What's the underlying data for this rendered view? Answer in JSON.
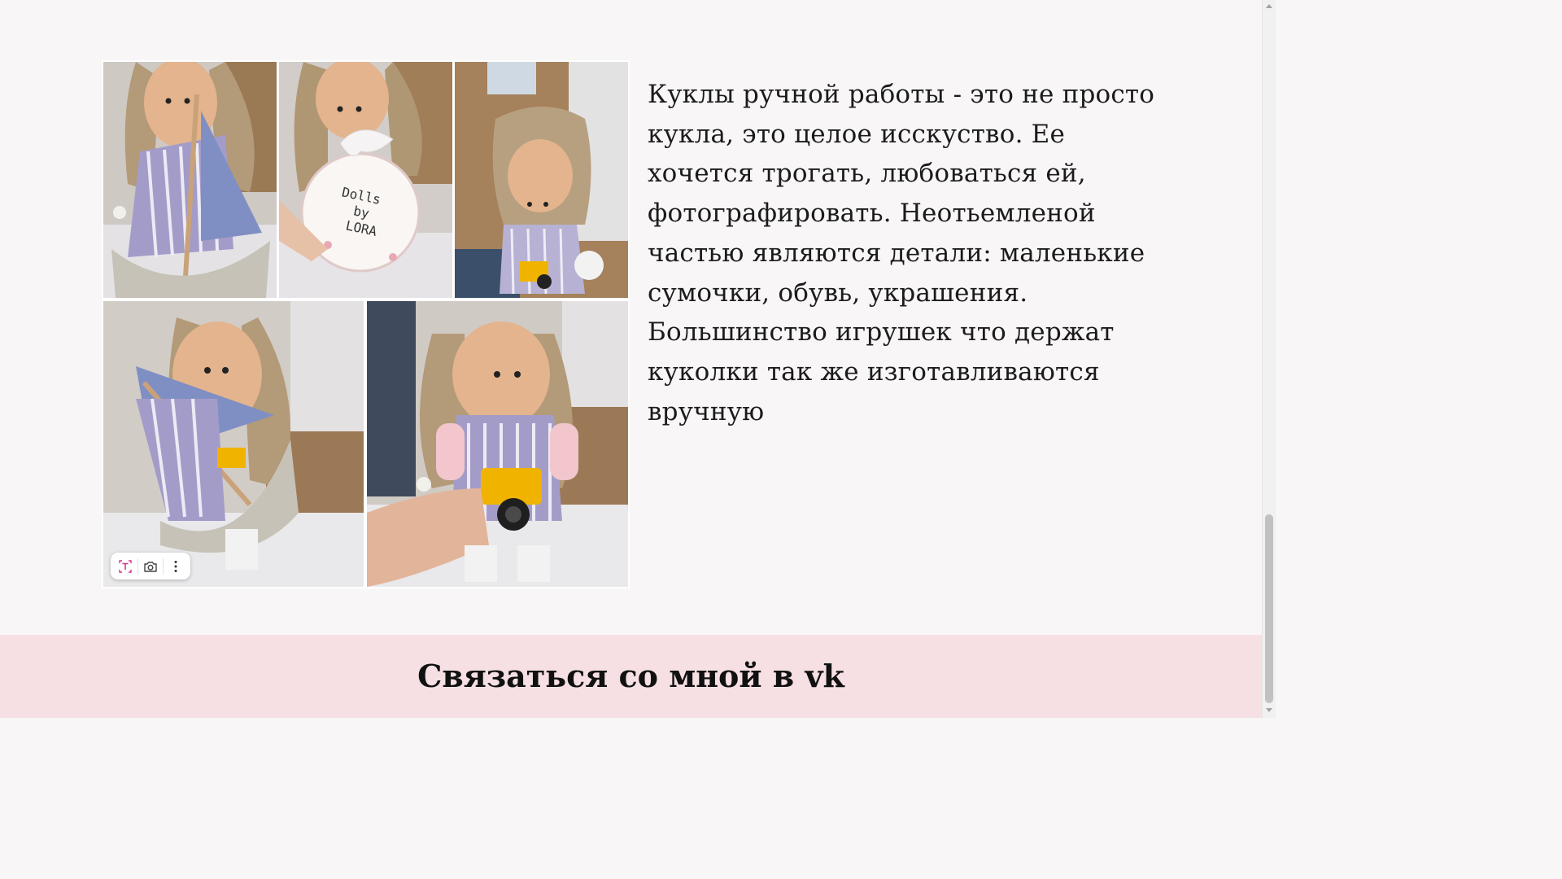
{
  "gallery": {
    "photos": [
      {
        "name": "doll-with-sailboat-photo"
      },
      {
        "name": "dolls-by-lora-tag-photo",
        "tag_text": "Dolls by LORA"
      },
      {
        "name": "doll-in-box-photo"
      },
      {
        "name": "doll-holding-sailboat-photo"
      },
      {
        "name": "doll-with-camera-photo"
      }
    ],
    "toolbar": {
      "text_select_icon": "text-select-icon",
      "camera_icon": "camera-icon",
      "more_icon": "more-vertical-icon"
    }
  },
  "description": "Куклы ручной работы - это не просто кукла, это целое исскуство. Ее хочется трогать, любоваться ей, фотографировать. Неотьемленой частью являются детали: маленькие сумочки, обувь, украшения. Большинство игрушек что держат куколки так же изготавливаются вручную",
  "footer": {
    "title": "Связаться со мной в vk"
  },
  "colors": {
    "page_background": "#f8f6f6",
    "footer_background": "#f6e0e3",
    "text": "#1b1b1b"
  }
}
